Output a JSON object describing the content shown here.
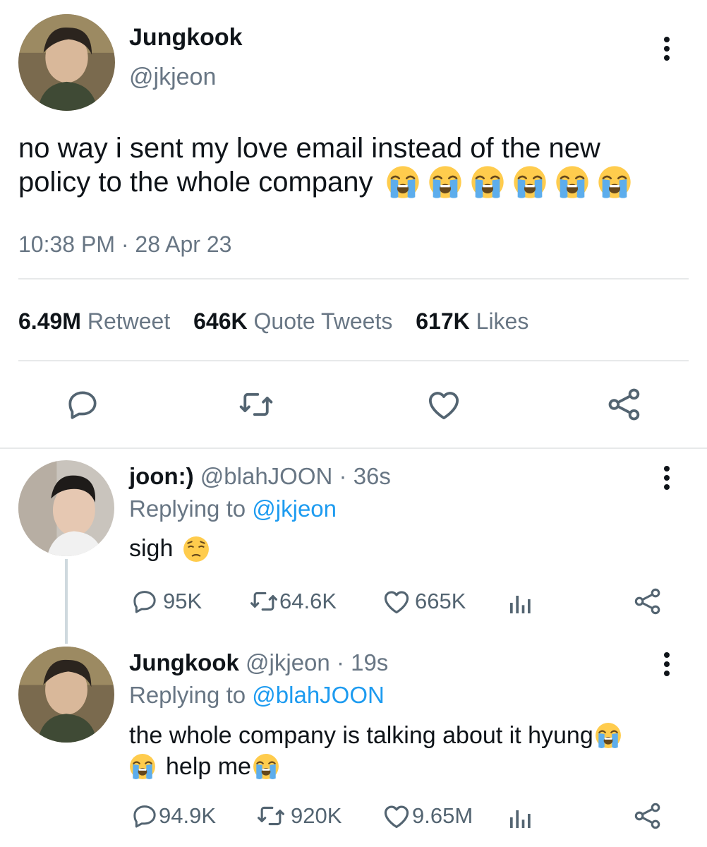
{
  "main_tweet": {
    "author_name": "Jungkook",
    "author_handle": "@jkjeon",
    "text_line1": "no way i sent my love email instead of the new",
    "text_line2": "policy to the whole company",
    "emoji": "loudly-crying-face",
    "emoji_count": 6,
    "timestamp": "10:38 PM · 28 Apr 23",
    "stats": {
      "retweets_value": "6.49M",
      "retweets_label": "Retweet",
      "quotes_value": "646K",
      "quotes_label": "Quote Tweets",
      "likes_value": "617K",
      "likes_label": "Likes"
    },
    "actions": [
      "reply-icon",
      "retweet-icon",
      "like-icon",
      "share-icon"
    ]
  },
  "reply1": {
    "author_name": "joon:)",
    "author_handle": "@blahJOON",
    "time": "· 36s",
    "replying_prefix": "Replying to",
    "replying_to": "@jkjeon",
    "text": "sigh",
    "emoji": "pensive-face",
    "replies": "95K",
    "retweets": "64.6K",
    "likes": "665K"
  },
  "reply2": {
    "author_name": "Jungkook",
    "author_handle": "@jkjeon",
    "time": "· 19s",
    "replying_prefix": "Replying to",
    "replying_to": "@blahJOON",
    "text_line1": "the whole company is talking about it hyung",
    "text_line2": "help me",
    "emoji": "loudly-crying-face",
    "replies": "94.9K",
    "retweets": "920K",
    "likes": "9.65M"
  },
  "colors": {
    "text": "#0f1419",
    "secondary": "#687684",
    "link": "#1d9bf0",
    "divider": "#e7e9ea",
    "emoji_face": "#ffcc4d",
    "emoji_tears": "#5dadec"
  }
}
